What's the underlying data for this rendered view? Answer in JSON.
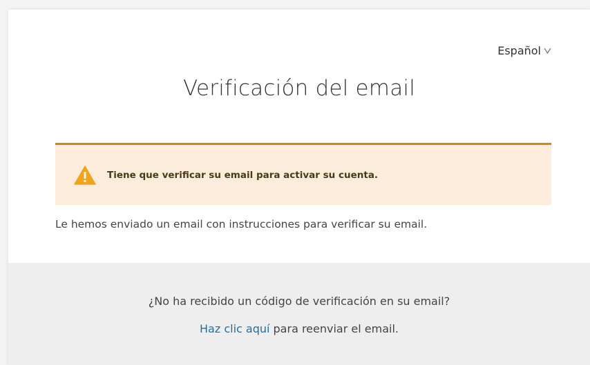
{
  "language_selector": {
    "label": "Español",
    "icon": "chevron-down-icon"
  },
  "page": {
    "title": "Verificación del email"
  },
  "alert": {
    "icon": "warning-icon",
    "message": "Tiene que verificar su email para activar su cuenta.",
    "colors": {
      "background": "#fdebdb",
      "border": "#d4830f",
      "icon": "#f0a41c"
    }
  },
  "info_text": "Le hemos enviado un email con instrucciones para verificar su email.",
  "footer": {
    "question": "¿No ha recibido un código de verificación en su email?",
    "link_text": "Haz clic aquí",
    "after_link": " para reenviar el email.",
    "link_color": "#1f6fa8"
  }
}
